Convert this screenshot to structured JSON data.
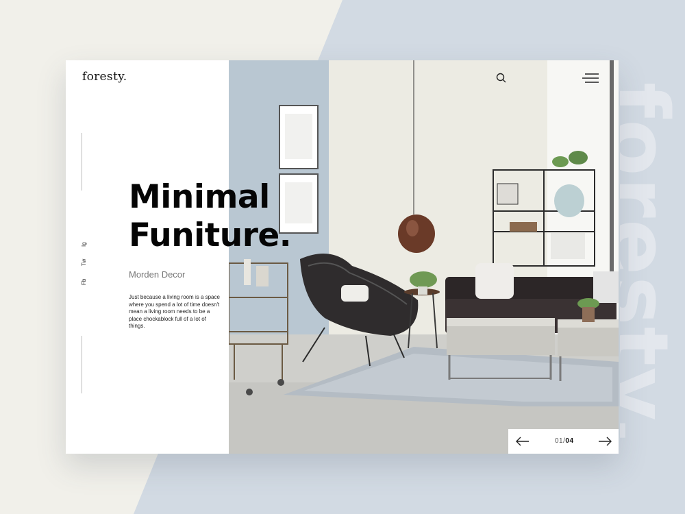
{
  "brand": {
    "logo": "foresty.",
    "background_word": "foresty."
  },
  "social": {
    "items": [
      "Fb",
      "Tw",
      "Ig"
    ]
  },
  "hero": {
    "headline_line1": "Minimal",
    "headline_line2": "Funiture.",
    "subtitle": "Morden Decor",
    "description": "Just because a living room is a space where you spend a lot of time doesn't mean a living room needs to be a place chockablock full of a lot of things."
  },
  "pager": {
    "current": "01",
    "separator": "/",
    "total": "04"
  },
  "icons": {
    "search": "search-icon",
    "menu": "hamburger-menu-icon",
    "prev": "arrow-left-icon",
    "next": "arrow-right-icon"
  },
  "colors": {
    "backdrop": "#f1f0ea",
    "band": "#d2dae3",
    "text": "#050505"
  }
}
